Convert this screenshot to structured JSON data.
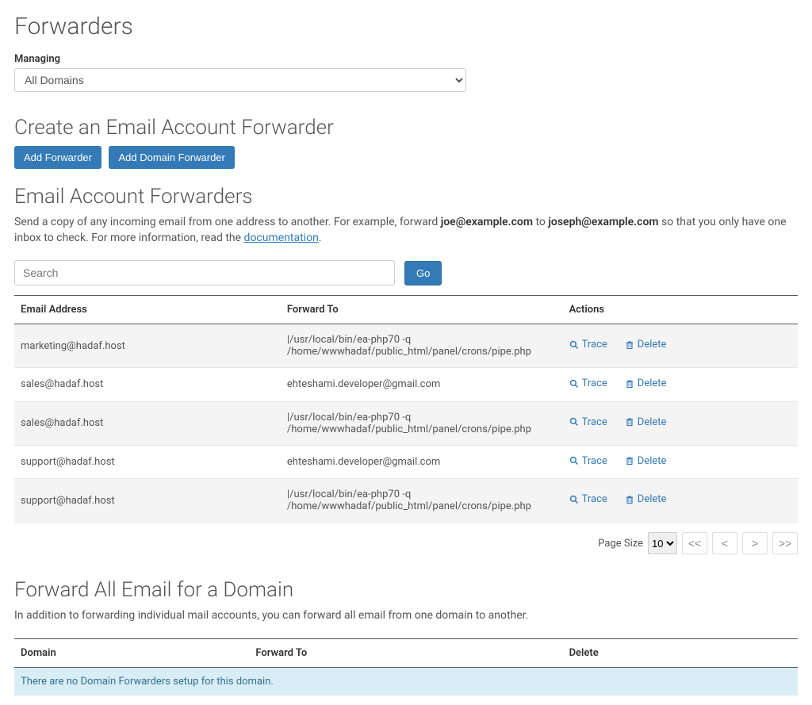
{
  "page_title": "Forwarders",
  "managing": {
    "label": "Managing",
    "selected": "All Domains"
  },
  "create": {
    "title": "Create an Email Account Forwarder",
    "add_forwarder_label": "Add Forwarder",
    "add_domain_forwarder_label": "Add Domain Forwarder"
  },
  "email_forwarders_section": {
    "title": "Email Account Forwarders",
    "desc_prefix": "Send a copy of any incoming email from one address to another. For example, forward ",
    "example1": "joe@example.com",
    "desc_mid": " to ",
    "example2": "joseph@example.com",
    "desc_suffix": " so that you only have one inbox to check. For more information, read the ",
    "doc_link_text": "documentation",
    "desc_end": "."
  },
  "search": {
    "placeholder": "Search",
    "go_label": "Go"
  },
  "table": {
    "headers": {
      "email": "Email Address",
      "forward_to": "Forward To",
      "actions": "Actions"
    },
    "action_trace": "Trace",
    "action_delete": "Delete",
    "rows": [
      {
        "email": "marketing@hadaf.host",
        "forward_to": "|/usr/local/bin/ea-php70 -q /home/wwwhadaf/public_html/panel/crons/pipe.php"
      },
      {
        "email": "sales@hadaf.host",
        "forward_to": "ehteshami.developer@gmail.com"
      },
      {
        "email": "sales@hadaf.host",
        "forward_to": "|/usr/local/bin/ea-php70 -q /home/wwwhadaf/public_html/panel/crons/pipe.php"
      },
      {
        "email": "support@hadaf.host",
        "forward_to": "ehteshami.developer@gmail.com"
      },
      {
        "email": "support@hadaf.host",
        "forward_to": "|/usr/local/bin/ea-php70 -q /home/wwwhadaf/public_html/panel/crons/pipe.php"
      }
    ]
  },
  "pagination": {
    "page_size_label": "Page Size",
    "page_size_value": "10",
    "first": "<<",
    "prev": "<",
    "next": ">",
    "last": ">>"
  },
  "domain_section": {
    "title": "Forward All Email for a Domain",
    "desc": "In addition to forwarding individual mail accounts, you can forward all email from one domain to another.",
    "headers": {
      "domain": "Domain",
      "forward_to": "Forward To",
      "delete": "Delete"
    },
    "empty_message": "There are no Domain Forwarders setup for this domain."
  }
}
